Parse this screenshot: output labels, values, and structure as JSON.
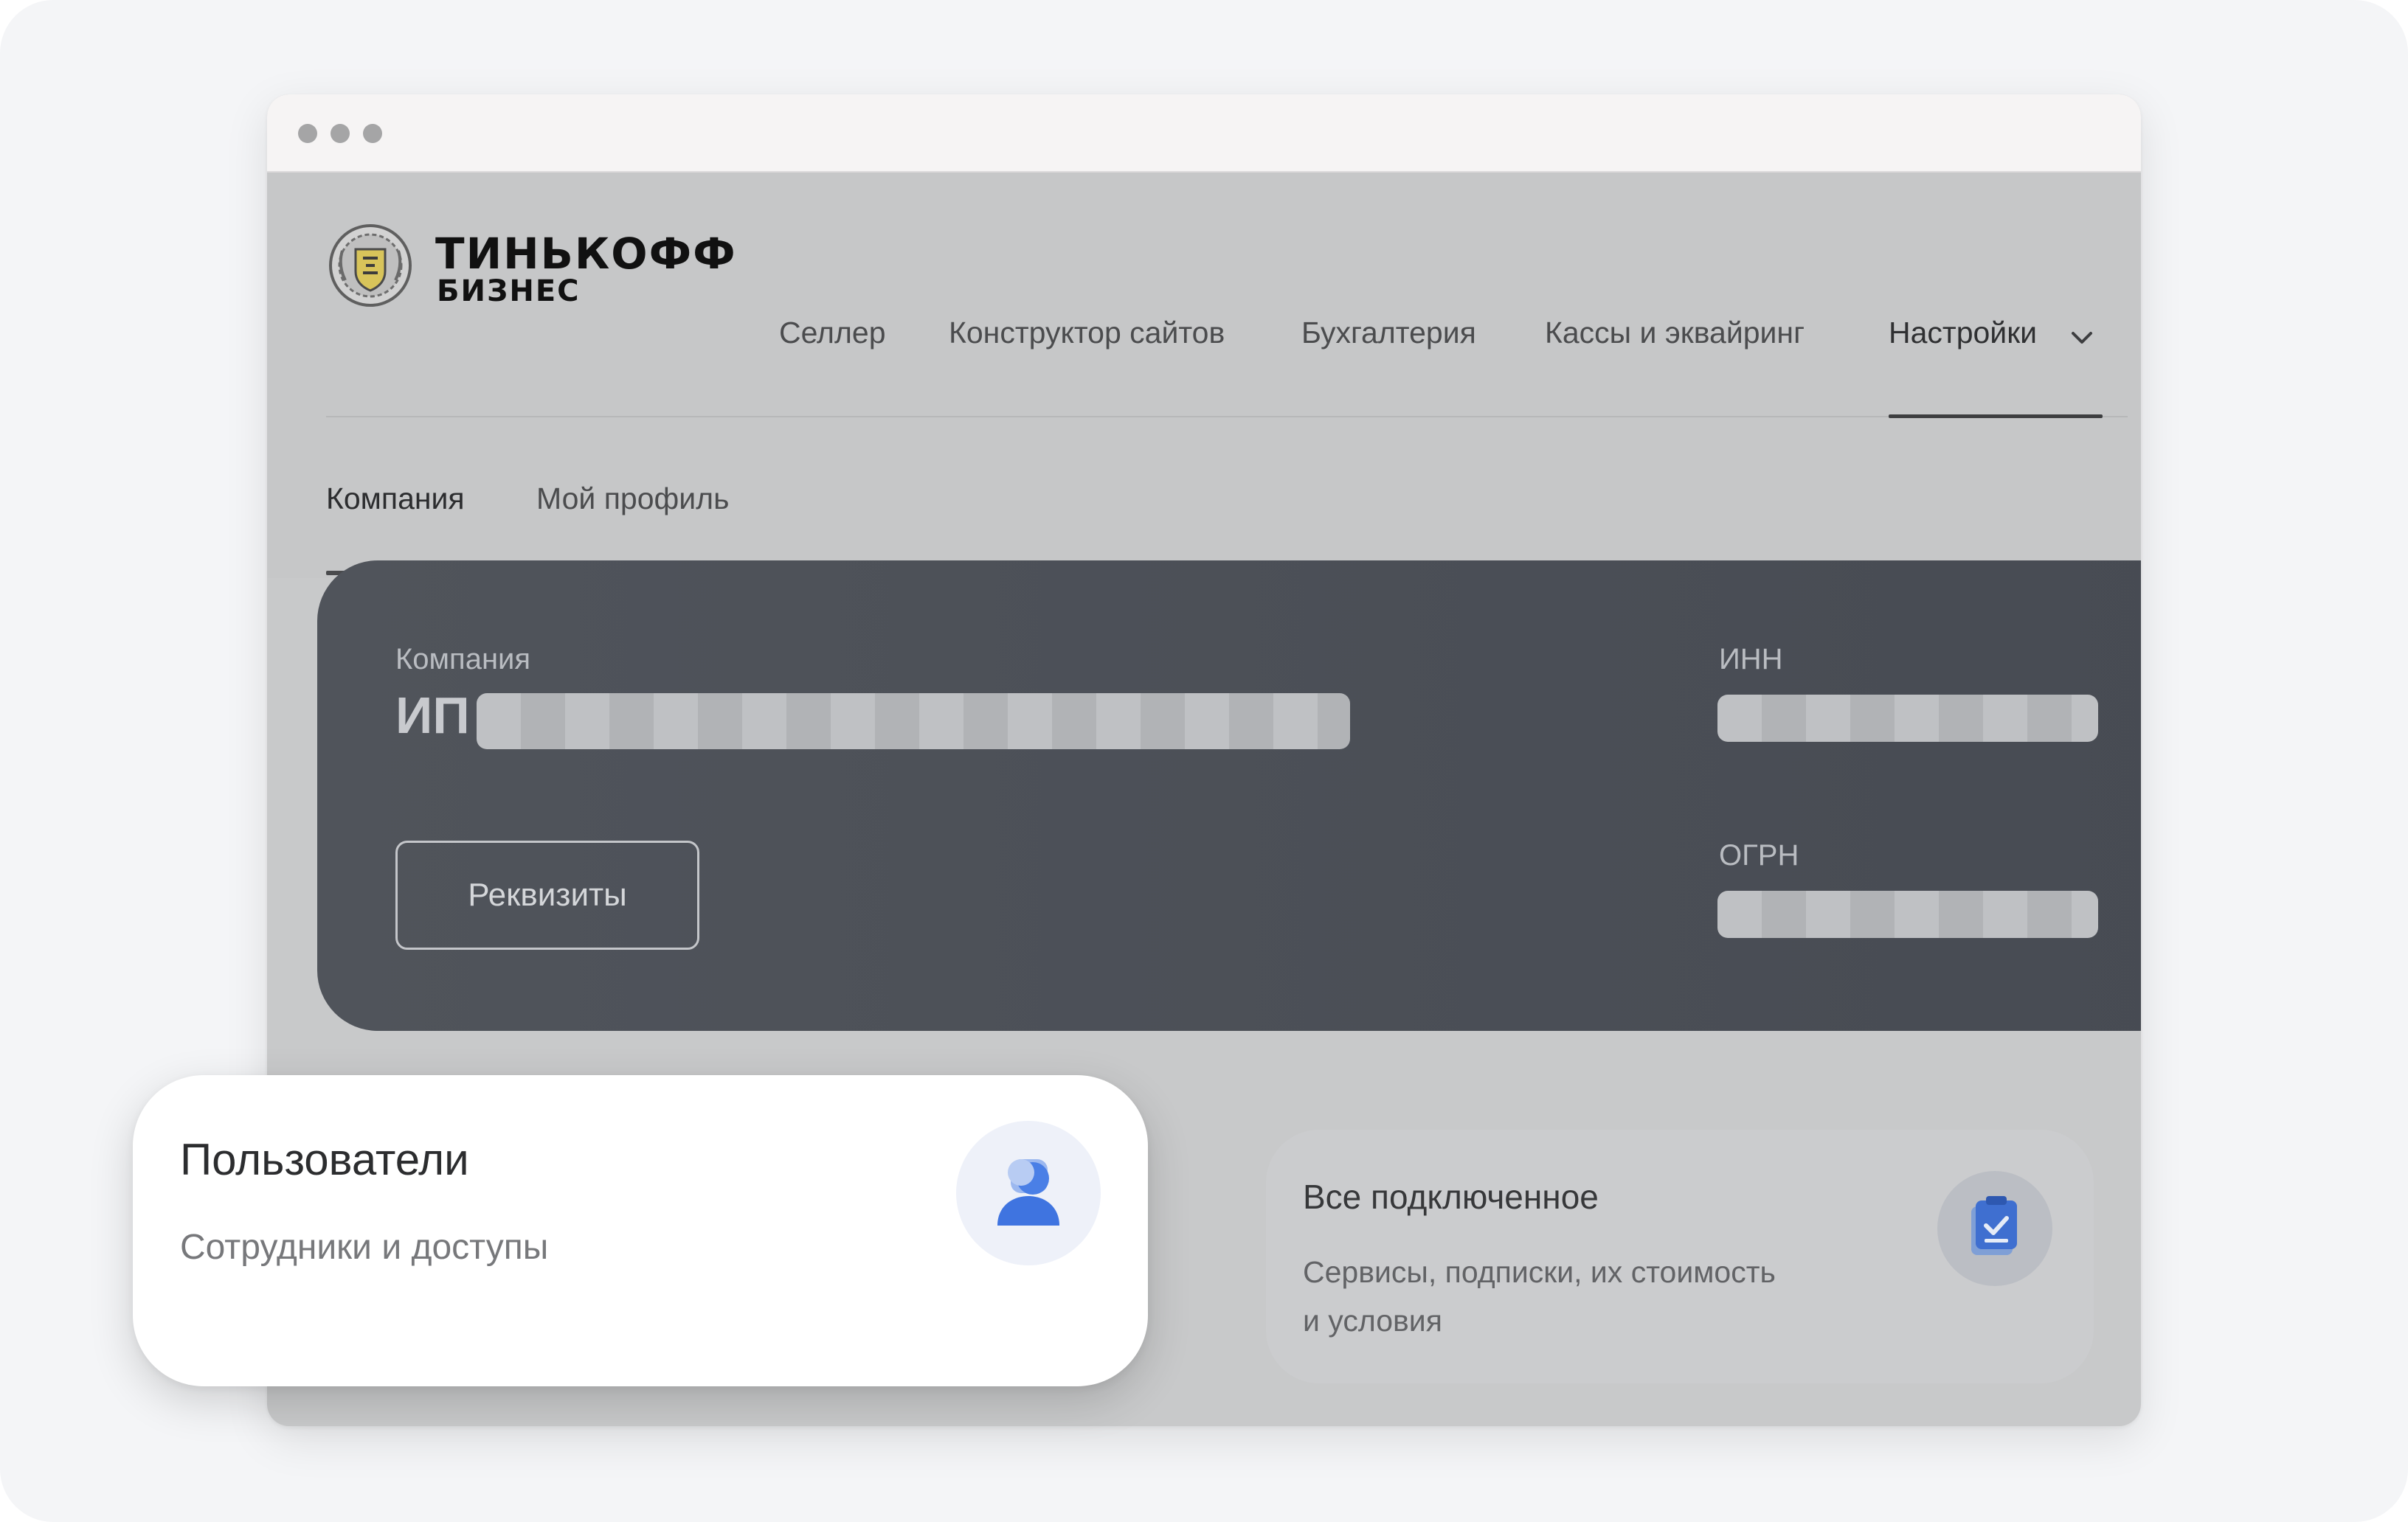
{
  "brand": {
    "line1": "ТИНЬКОФФ",
    "line2": "БИЗНЕС"
  },
  "nav": {
    "items": [
      {
        "label": "Селлер"
      },
      {
        "label": "Конструктор сайтов"
      },
      {
        "label": "Бухгалтерия"
      },
      {
        "label": "Кассы и эквайринг"
      },
      {
        "label": "Настройки"
      }
    ],
    "active": "Настройки"
  },
  "subtabs": {
    "items": [
      {
        "label": "Компания"
      },
      {
        "label": "Мой профиль"
      }
    ],
    "active": "Компания"
  },
  "company_card": {
    "company_label": "Компания",
    "company_prefix": "ИП",
    "inn_label": "ИНН",
    "ogrn_label": "ОГРН",
    "requisites_button": "Реквизиты"
  },
  "users_card": {
    "title": "Пользователи",
    "description": "Сотрудники и доступы",
    "icon": "users-icon"
  },
  "all_connected_card": {
    "title": "Все подключенное",
    "description_line1": "Сервисы, подписки, их стоимость",
    "description_line2": "и условия",
    "icon": "clipboard-check-icon"
  },
  "colors": {
    "accent_blue": "#3f7be8",
    "card_dark": "#4b4f57"
  }
}
